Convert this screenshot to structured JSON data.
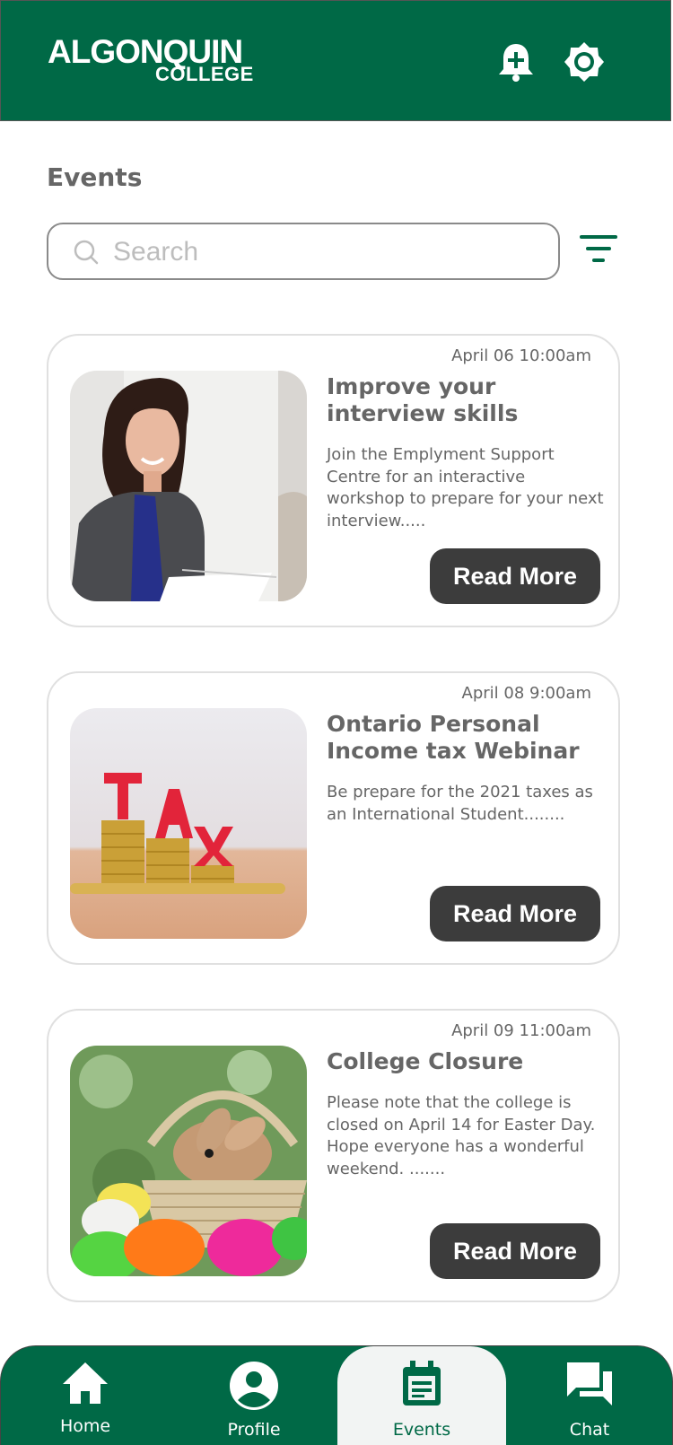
{
  "header": {
    "logo_line1": "ALGONQUIN",
    "logo_line2": "COLLEGE",
    "icons": [
      "bell-plus-icon",
      "settings-gear-icon"
    ],
    "brand_color": "#006946"
  },
  "page": {
    "title": "Events"
  },
  "search": {
    "placeholder": "Search",
    "value": ""
  },
  "events": [
    {
      "date": "April 06 10:00am",
      "title": "Improve your interview skills",
      "description": "Join the Emplyment Support Centre for an interactive workshop to prepare for your next interview.....",
      "button": "Read More",
      "image": "woman-in-interview-photo"
    },
    {
      "date": "April 08 9:00am",
      "title": "Ontario Personal Income tax Webinar",
      "description": "Be prepare for the 2021 taxes as an International Student........",
      "button": "Read More",
      "image": "tax-coins-photo"
    },
    {
      "date": "April 09 11:00am",
      "title": "College Closure",
      "description": "Please note that the college is closed on April 14 for Easter Day. Hope everyone has a wonderful weekend. .......",
      "button": "Read More",
      "image": "easter-bunny-eggs-photo"
    }
  ],
  "tabbar": {
    "items": [
      {
        "label": "Home",
        "icon": "home-icon"
      },
      {
        "label": "Profile",
        "icon": "profile-icon"
      },
      {
        "label": "Events",
        "icon": "calendar-icon",
        "active": true
      },
      {
        "label": "Chat",
        "icon": "chat-icon"
      }
    ]
  }
}
